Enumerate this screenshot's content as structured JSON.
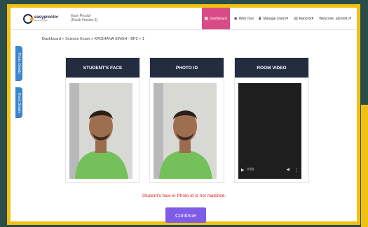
{
  "header": {
    "logo_name": "easyproctor",
    "logo_sub": "Remote Mode",
    "app_line1": "Easy Proctor",
    "app_line2": "(Kiosk Version 5)",
    "nav": {
      "dashboard": "Dashboard",
      "tour": "Web Tour",
      "manage_users": "Manage Users",
      "reports": "Reports",
      "welcome": "Welcome, admin01"
    }
  },
  "breadcrumb": "Dashboard > Science Exam > KRISHANA SINGH - BP2 > 1",
  "side_tabs": {
    "photo": "Photo Details",
    "kiosk": "Kiosk Details"
  },
  "cards": [
    {
      "title": "STUDENT'S FACE"
    },
    {
      "title": "PHOTO ID"
    },
    {
      "title": "ROOM VIDEO"
    }
  ],
  "video": {
    "time": "0:00"
  },
  "error_message": "Student's face in Photo id is not matched.",
  "continue_label": "Continue",
  "icons": {
    "dashboard": "dashboard-icon",
    "tour": "tour-icon",
    "users": "user-icon",
    "reports": "report-icon"
  }
}
